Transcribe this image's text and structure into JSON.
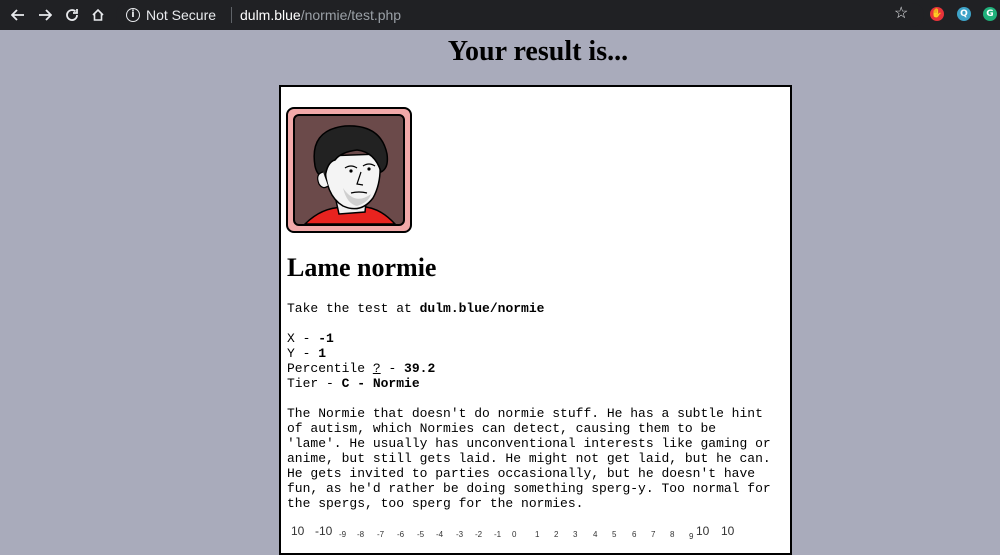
{
  "browser": {
    "back_icon": "arrow-left-icon",
    "forward_icon": "arrow-right-icon",
    "reload_icon": "reload-icon",
    "home_icon": "home-icon",
    "security_label": "Not Secure",
    "url_host": "dulm.blue",
    "url_path": "/normie/test.php"
  },
  "page": {
    "title": "Your result is...",
    "result_name": "Lame normie",
    "take_test_prefix": "Take the test at ",
    "take_test_link": "dulm.blue/normie",
    "x_label": "X - ",
    "x_value": "-1",
    "y_label": "Y - ",
    "y_value": "1",
    "percentile_label": "Percentile ",
    "percentile_link": "?",
    "percentile_sep": " - ",
    "percentile_value": "39.2",
    "tier_label": "Tier - ",
    "tier_value": "C - Normie",
    "description": "The Normie that doesn't do normie stuff. He has a subtle hint\nof autism, which Normies can detect, causing them to be\n'lame'. He usually has unconventional interests like gaming or\nanime, but still gets laid. He might not get laid, but he can.\nHe gets invited to parties occasionally, but he doesn't have\nfun, as he'd rather be doing something sperg-y. Too normal for\nthe spergs, too sperg for the normies.",
    "scale_labels": [
      "10",
      "-10",
      "-9",
      "-8",
      "-7",
      "-6",
      "-5",
      "-4",
      "-3",
      "-2",
      "-1",
      "0",
      "1",
      "2",
      "3",
      "4",
      "5",
      "6",
      "7",
      "8",
      "9",
      "10",
      "10"
    ]
  }
}
